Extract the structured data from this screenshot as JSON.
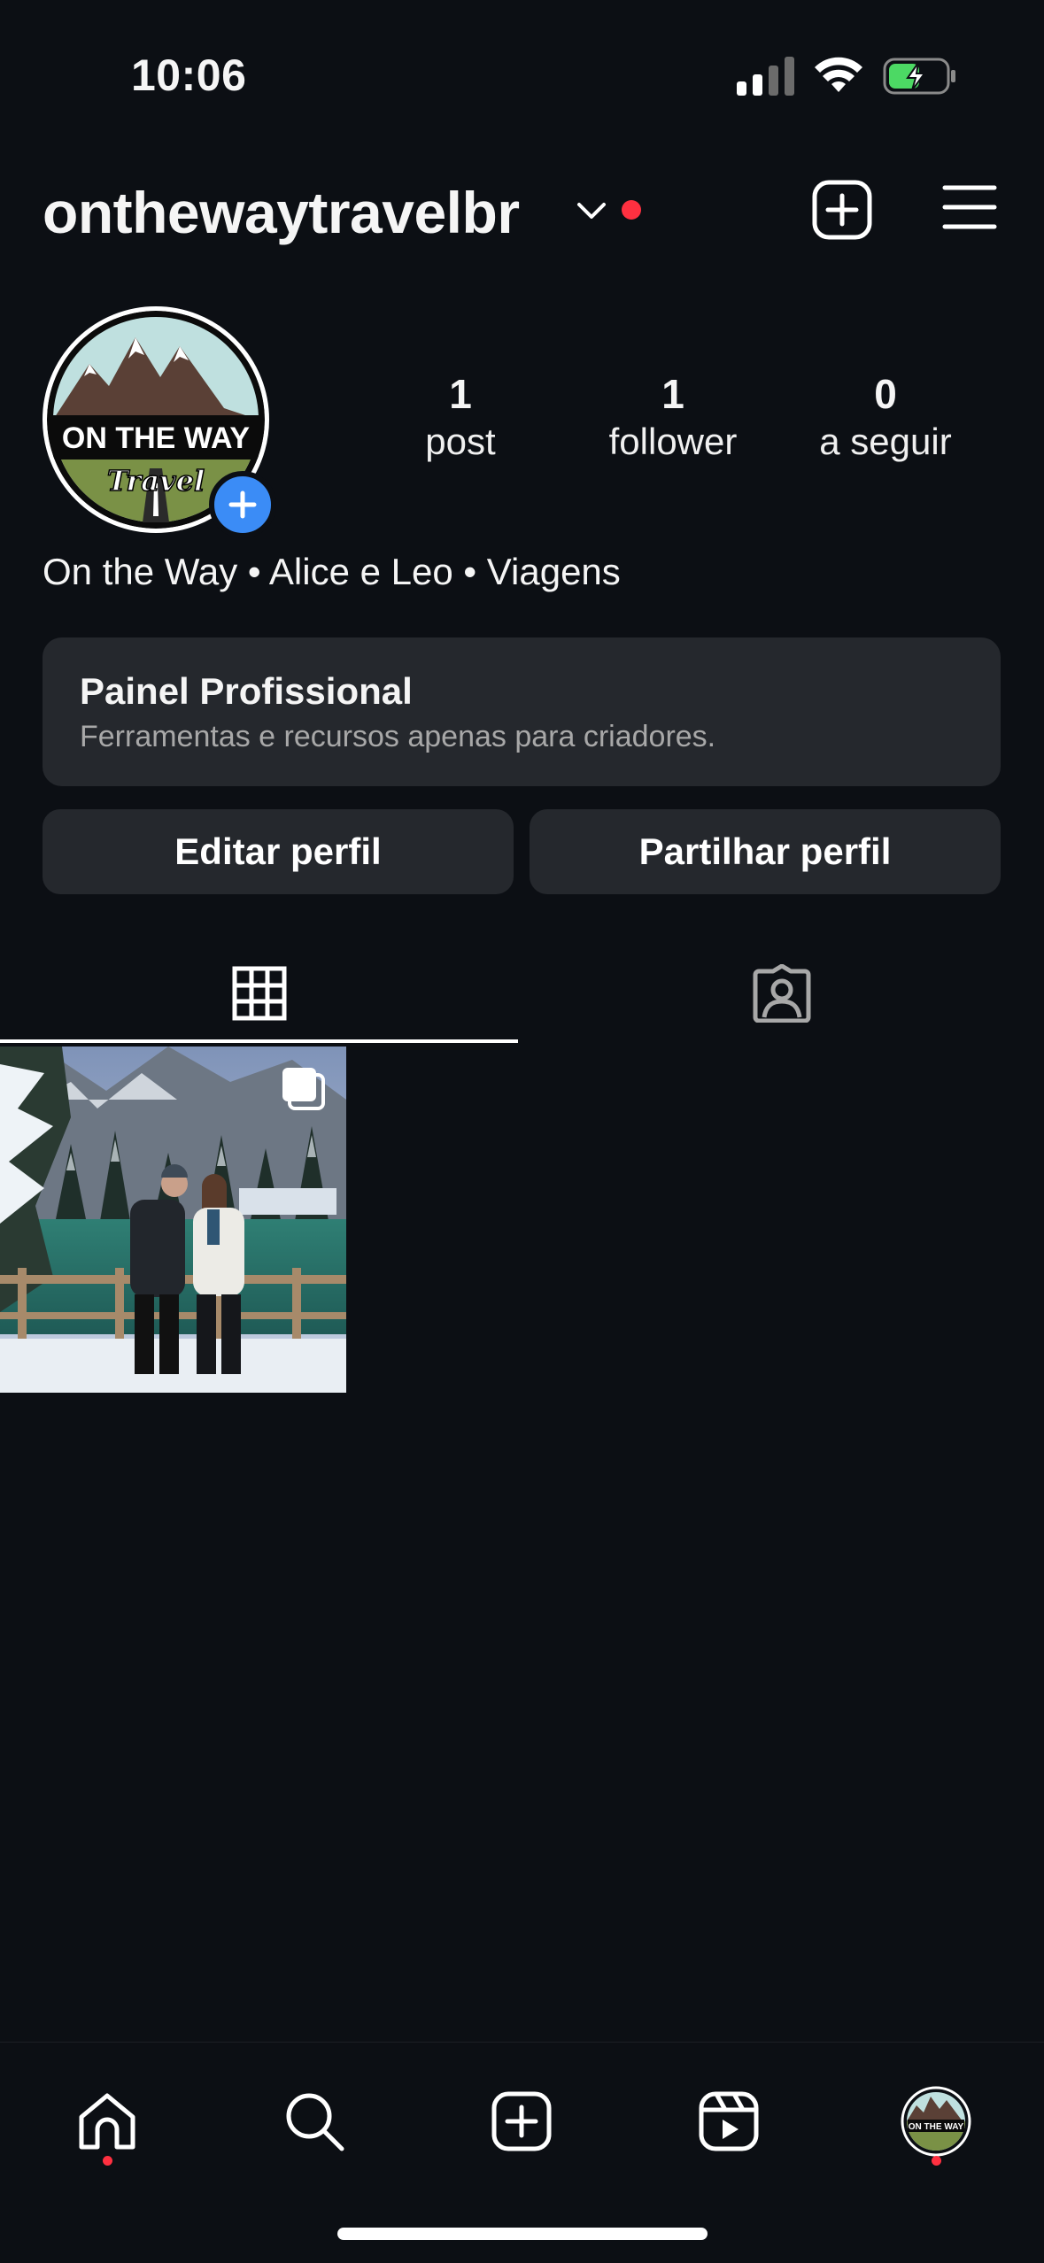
{
  "status_bar": {
    "time": "10:06",
    "icons": [
      "cellular-signal-icon",
      "wifi-icon",
      "battery-charging-icon"
    ]
  },
  "header": {
    "username": "onthewaytravelbr",
    "icons": [
      "chevron-down-icon",
      "notification-dot",
      "create-post-icon",
      "menu-icon"
    ]
  },
  "profile": {
    "avatar_logo": "ON THE WAY Travel",
    "stats": [
      {
        "value": "1",
        "label": "post"
      },
      {
        "value": "1",
        "label": "follower"
      },
      {
        "value": "0",
        "label": "a seguir"
      }
    ],
    "bio": "On the Way • Alice e Leo • Viagens"
  },
  "pro_panel": {
    "title": "Painel Profissional",
    "subtitle": "Ferramentas e recursos apenas para criadores."
  },
  "buttons": {
    "edit": "Editar perfil",
    "share": "Partilhar perfil"
  },
  "tabs": [
    "grid-icon",
    "tagged-icon"
  ],
  "posts": [
    {
      "type": "carousel",
      "description_icon": "multiple-photos-icon"
    }
  ],
  "bottom_nav": [
    "home-icon",
    "search-icon",
    "create-icon",
    "reels-icon",
    "profile-avatar"
  ],
  "colors": {
    "background": "#0c0f14",
    "surface": "#25282d",
    "accent_blue": "#3b8cf6",
    "notification_red": "#ff3040",
    "battery_green": "#4cd964"
  }
}
